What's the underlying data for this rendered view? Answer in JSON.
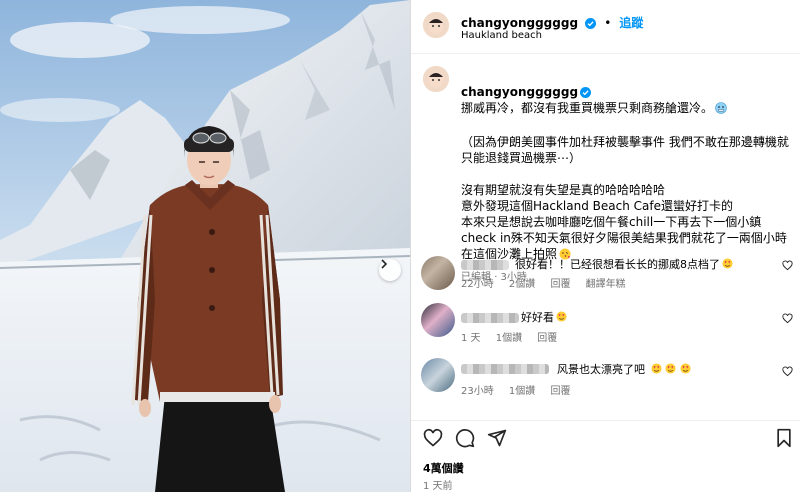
{
  "post": {
    "username": "changyongggggg",
    "follow_label": "追蹤",
    "location": "Haukland beach",
    "caption_title": "挪威再冷，都沒有我重買機票只剩商務艙還冷。",
    "caption_body": "（因為伊朗美國事件加杜拜被襲擊事件 我們不敢在那邊轉機就只能退錢買過機票⋯）\n\n沒有期望就沒有失望是真的哈哈哈哈哈\n意外發現這個Hackland Beach Cafe還蠻好打卡的\n本來只是想說去咖啡廳吃個午餐chill一下再去下一個小鎮check in殊不知天氣很好夕陽很美結果我們就花了一兩個小時在這個沙灘上拍照",
    "edited_label": "已編輯",
    "edited_time": "3小時",
    "likes": "4萬個讚",
    "time_ago": "1 天前"
  },
  "comments": [
    {
      "text": "很好看！！已经很想看长长的挪威8点档了",
      "time": "22小時",
      "likes": "2個讚",
      "reply": "回覆",
      "translate": "翻譯年糕"
    },
    {
      "text": "好好看",
      "time": "1 天",
      "likes": "1個讚",
      "reply": "回覆",
      "translate": ""
    },
    {
      "text": "风景也太漂亮了吧",
      "time": "23小時",
      "likes": "1個讚",
      "reply": "回覆",
      "translate": ""
    }
  ],
  "icons": {
    "verified": "verified-badge-icon",
    "emoji_cold": "cold-face-emoji",
    "emoji_heart_eyes": "heart-eyes-emoji",
    "emoji_kiss": "kissing-heart-emoji",
    "like": "heart-icon",
    "comment": "comment-icon",
    "share": "share-icon",
    "save": "bookmark-icon",
    "next": "chevron-right-icon"
  },
  "colors": {
    "accent": "#0095f6",
    "muted": "#737373",
    "jacket": "#7a3a24"
  }
}
